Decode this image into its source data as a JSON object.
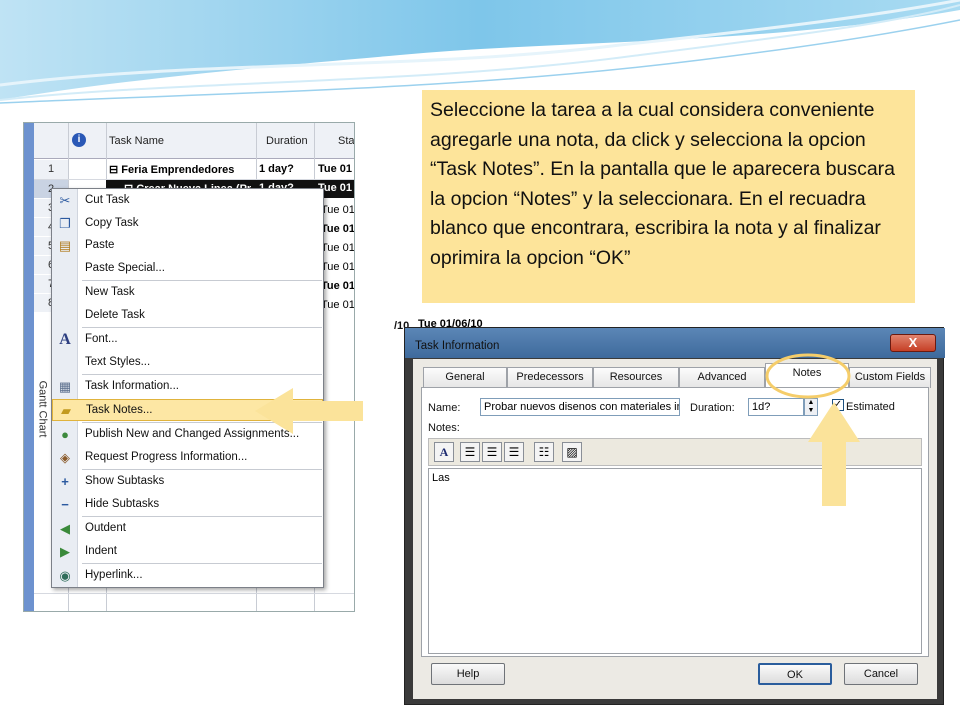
{
  "colors": {
    "callout_bg": "#fde49a",
    "arrow": "#fbe39a",
    "highlight": "#fde7a4",
    "circle": "#f5cd6a"
  },
  "callout": {
    "text": "Seleccione la tarea a la cual considera conveniente agregarle una nota, da click y selecciona la opcion “Task Notes”. En la pantalla que le aparecera buscara la opcion “Notes” y la seleccionara. En el recuadra blanco que encontrara, escribira la nota y al finalizar oprimira la opcion “OK”"
  },
  "grid": {
    "side_label": "Gantt Chart",
    "info_icon": "i",
    "headers": {
      "name": "Task Name",
      "duration": "Duration",
      "start": "Sta"
    },
    "rows": [
      {
        "num": "1",
        "name": "Feria Emprendedores",
        "duration": "1 day?",
        "start": "Tue 01"
      },
      {
        "num": "2",
        "name": "Crear Nueva Linea (Pr",
        "duration": "1 day?",
        "start": "Tue 01"
      },
      {
        "num": "3",
        "start": "Tue 01"
      },
      {
        "num": "4",
        "start": "Tue 01"
      },
      {
        "num": "5",
        "start": "Tue 01"
      },
      {
        "num": "6",
        "start": "Tue 01"
      },
      {
        "num": "7",
        "start": "Tue 01"
      },
      {
        "num": "8",
        "start": "Tue 01"
      }
    ]
  },
  "menu": {
    "items": [
      {
        "label": "Cut Task",
        "icon": "scissors-icon"
      },
      {
        "label": "Copy Task",
        "icon": "copy-icon"
      },
      {
        "label": "Paste",
        "icon": "paste-icon"
      },
      {
        "label": "Paste Special...",
        "icon": ""
      },
      {
        "label": "New Task",
        "icon": ""
      },
      {
        "label": "Delete Task",
        "icon": ""
      },
      {
        "label": "Font...",
        "icon": "font-icon"
      },
      {
        "label": "Text Styles...",
        "icon": ""
      },
      {
        "label": "Task Information...",
        "icon": "task-info-icon"
      },
      {
        "label": "Task Notes...",
        "icon": "note-icon"
      },
      {
        "label": "Publish New and Changed Assignments...",
        "icon": "publish-icon"
      },
      {
        "label": "Request Progress Information...",
        "icon": "request-icon"
      },
      {
        "label": "Show Subtasks",
        "icon": "plus-icon"
      },
      {
        "label": "Hide Subtasks",
        "icon": "minus-icon"
      },
      {
        "label": "Outdent",
        "icon": "outdent-icon"
      },
      {
        "label": "Indent",
        "icon": "indent-icon"
      },
      {
        "label": "Hyperlink...",
        "icon": "hyperlink-icon"
      }
    ]
  },
  "background_strip": {
    "date_header": "Tue 01/06/10",
    "left_fragment": "/10"
  },
  "dialog": {
    "title": "Task Information",
    "close": "X",
    "tabs": [
      "General",
      "Predecessors",
      "Resources",
      "Advanced",
      "Notes",
      "Custom Fields"
    ],
    "active_tab": "Notes",
    "name_label": "Name:",
    "name_value": "Probar nuevos disenos con materiales inn",
    "duration_label": "Duration:",
    "duration_value": "1d?",
    "estimated_label": "Estimated",
    "notes_label": "Notes:",
    "notes_value": "Las",
    "help_button": "Help",
    "ok_button": "OK",
    "cancel_button": "Cancel"
  }
}
